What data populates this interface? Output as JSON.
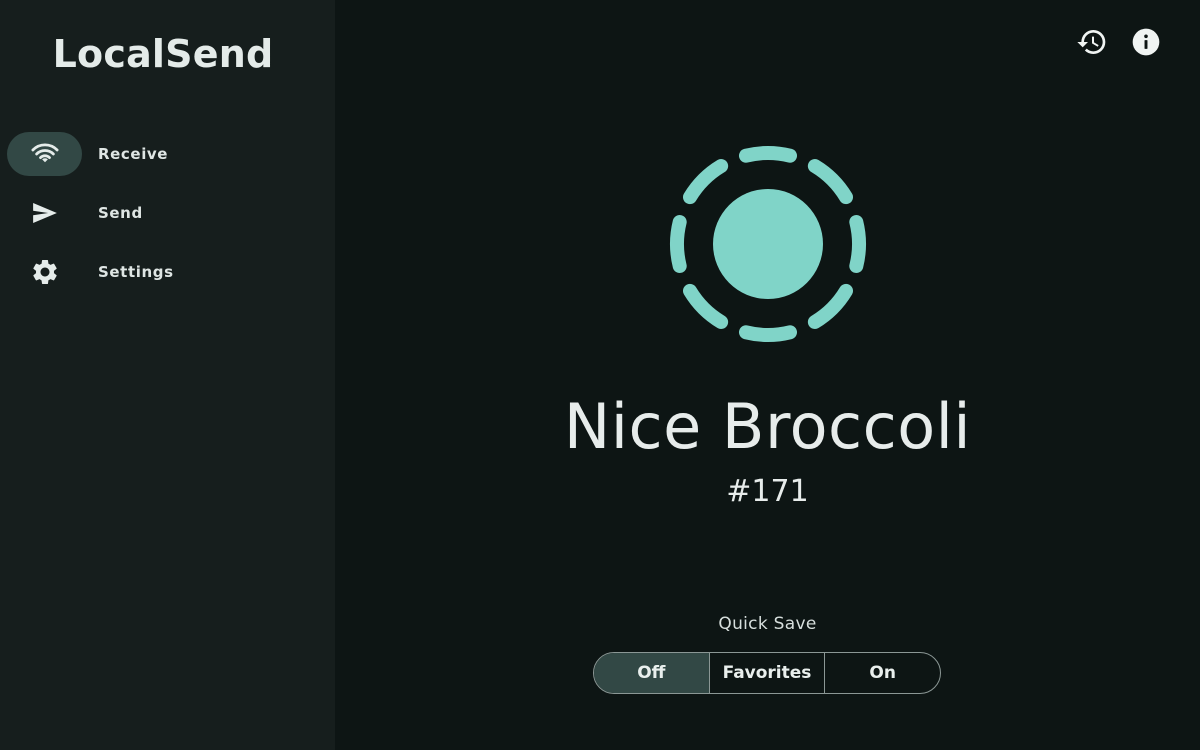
{
  "app": {
    "title": "LocalSend"
  },
  "sidebar": {
    "items": [
      {
        "label": "Receive",
        "icon": "wifi-icon",
        "active": true
      },
      {
        "label": "Send",
        "icon": "send-icon",
        "active": false
      },
      {
        "label": "Settings",
        "icon": "gear-icon",
        "active": false
      }
    ]
  },
  "header": {
    "icons": [
      "history-icon",
      "info-icon"
    ]
  },
  "device": {
    "name": "Nice Broccoli",
    "id": "#171"
  },
  "quick_save": {
    "label": "Quick Save",
    "options": [
      "Off",
      "Favorites",
      "On"
    ],
    "selected": "Off"
  },
  "colors": {
    "accent": "#80d4c8",
    "sidebar_bg": "#161e1d",
    "main_bg": "#0d1514",
    "selected_bg": "#324845"
  }
}
